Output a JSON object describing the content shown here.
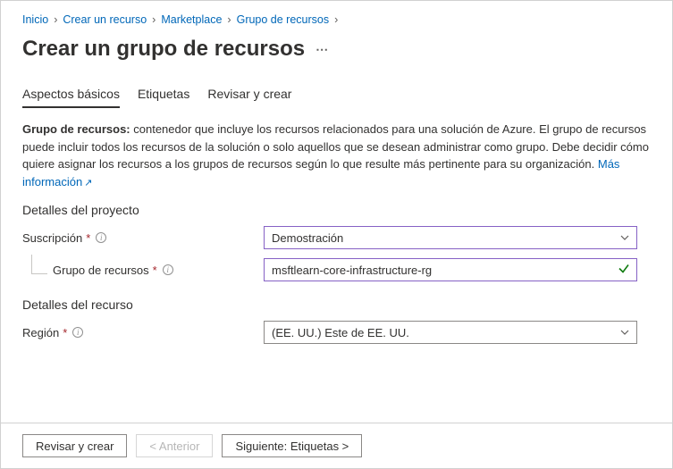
{
  "breadcrumb": {
    "items": [
      "Inicio",
      "Crear un recurso",
      "Marketplace",
      "Grupo de recursos"
    ]
  },
  "page": {
    "title": "Crear un grupo de recursos"
  },
  "tabs": {
    "basic": "Aspectos básicos",
    "tags": "Etiquetas",
    "review": "Revisar y crear"
  },
  "desc": {
    "label": "Grupo de recursos:",
    "text": " contenedor que incluye los recursos relacionados para una solución de Azure. El grupo de recursos puede incluir todos los recursos de la solución o solo aquellos que se desean administrar como grupo. Debe decidir cómo quiere asignar los recursos a los grupos de recursos según lo que resulte más pertinente para su organización. ",
    "link": "Más información"
  },
  "sections": {
    "project": {
      "title": "Detalles del proyecto",
      "subscription": {
        "label": "Suscripción",
        "value": "Demostración"
      },
      "resourceGroup": {
        "label": "Grupo de recursos",
        "value": "msftlearn-core-infrastructure-rg"
      }
    },
    "resource": {
      "title": "Detalles del recurso",
      "region": {
        "label": "Región",
        "value": "(EE. UU.) Este de EE. UU."
      }
    }
  },
  "footer": {
    "review": "Revisar y crear",
    "prev": "< Anterior",
    "next": "Siguiente: Etiquetas >"
  }
}
